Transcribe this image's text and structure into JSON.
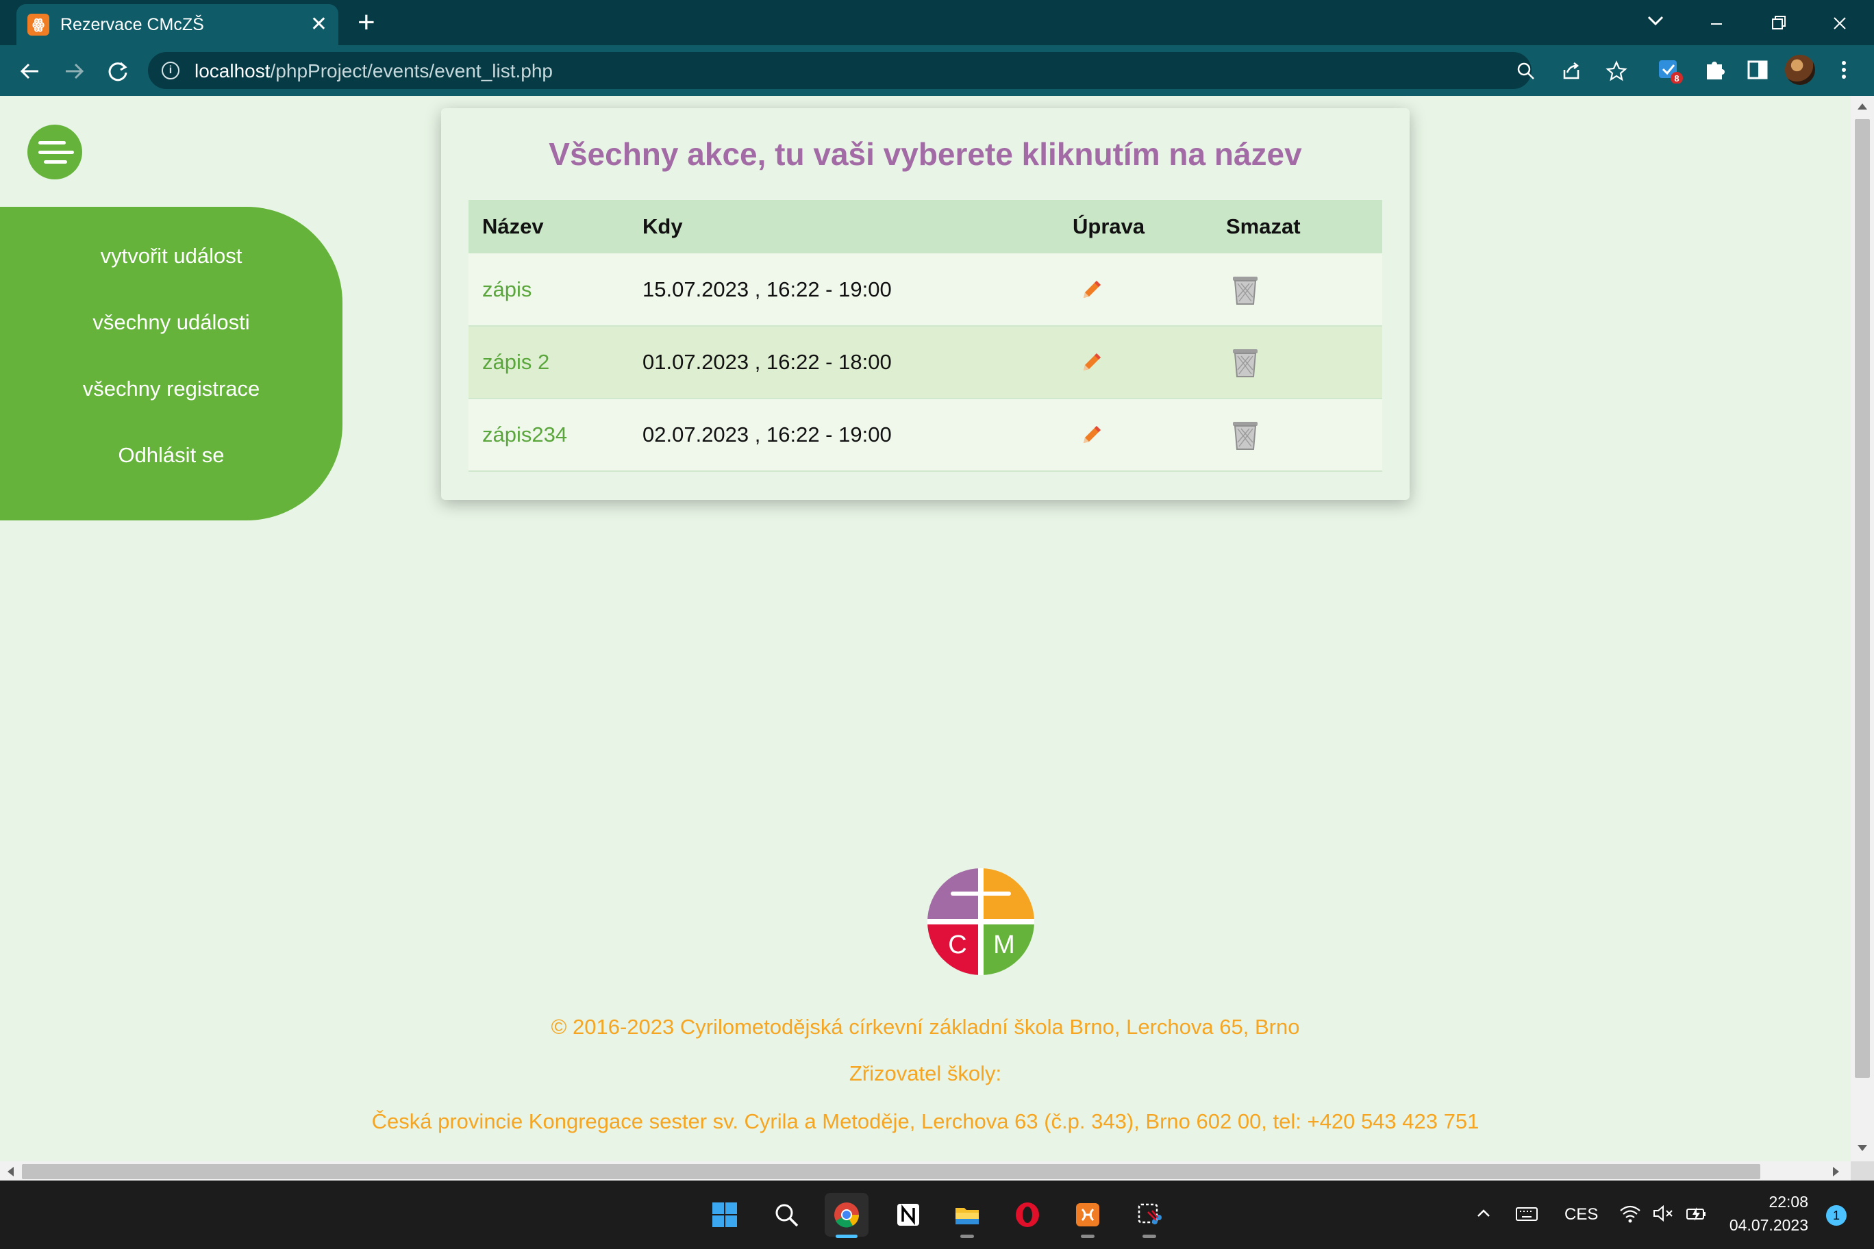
{
  "browser": {
    "tab_title": "Rezervace CMcZŠ",
    "tab_favicon_text": "ꙮ",
    "url_host": "localhost",
    "url_path": "/phpProject/events/event_list.php",
    "extension_badge": "8"
  },
  "sidebar": {
    "items": [
      {
        "label": "vytvořit událost"
      },
      {
        "label": "všechny události"
      },
      {
        "label": "všechny registrace"
      },
      {
        "label": "Odhlásit se"
      }
    ]
  },
  "main": {
    "title": "Všechny akce, tu vaši vyberete kliknutím na název",
    "columns": [
      "Název",
      "Kdy",
      "Úprava",
      "Smazat"
    ],
    "events": [
      {
        "name": "zápis",
        "when": "15.07.2023 , 16:22 - 19:00"
      },
      {
        "name": "zápis 2",
        "when": "01.07.2023 , 16:22 - 18:00"
      },
      {
        "name": "zápis234",
        "when": "02.07.2023 , 16:22 - 19:00"
      }
    ]
  },
  "footer": {
    "logo_letters": [
      "C",
      "M"
    ],
    "copyright": "© 2016-2023 Cyrilometodějská církevní základní škola Brno, Lerchova 65, Brno",
    "founder_label": "Zřizovatel školy:",
    "founder": "Česká provincie Kongregace sester sv. Cyrila a Metoděje, Lerchova 63 (č.p. 343), Brno 602 00, tel: +420 543 423 751"
  },
  "taskbar": {
    "language": "CES",
    "time": "22:08",
    "date": "04.07.2023",
    "notifications": "1"
  },
  "colors": {
    "accent_green": "#65b33b",
    "title_purple": "#a36ba5",
    "footer_orange": "#f5a522",
    "browser_teal": "#0f5c68"
  }
}
